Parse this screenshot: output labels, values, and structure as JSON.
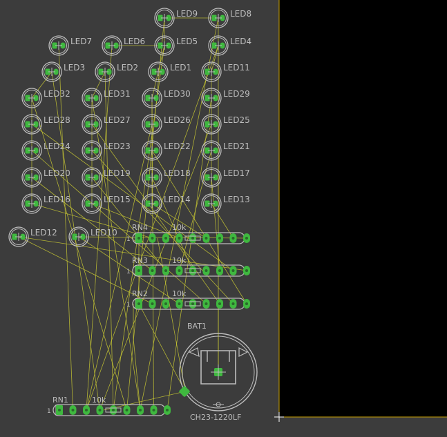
{
  "colors": {
    "background": "#3c3c3c",
    "board_outside": "#000000",
    "board_edge": "#c8a000",
    "silkscreen": "#bdbdbd",
    "pad": "#3fb83f",
    "airwire": "#c8c832"
  },
  "leds": [
    {
      "id": "LED9",
      "label": "LED9"
    },
    {
      "id": "LED8",
      "label": "LED8"
    },
    {
      "id": "LED7",
      "label": "LED7"
    },
    {
      "id": "LED6",
      "label": "LED6"
    },
    {
      "id": "LED5",
      "label": "LED5"
    },
    {
      "id": "LED4",
      "label": "LED4"
    },
    {
      "id": "LED3",
      "label": "LED3"
    },
    {
      "id": "LED2",
      "label": "LED2"
    },
    {
      "id": "LED1",
      "label": "LED1"
    },
    {
      "id": "LED11",
      "label": "LED11"
    },
    {
      "id": "LED32",
      "label": "LED32"
    },
    {
      "id": "LED31",
      "label": "LED31"
    },
    {
      "id": "LED30",
      "label": "LED30"
    },
    {
      "id": "LED29",
      "label": "LED29"
    },
    {
      "id": "LED28",
      "label": "LED28"
    },
    {
      "id": "LED27",
      "label": "LED27"
    },
    {
      "id": "LED26",
      "label": "LED26"
    },
    {
      "id": "LED25",
      "label": "LED25"
    },
    {
      "id": "LED24",
      "label": "LED24"
    },
    {
      "id": "LED23",
      "label": "LED23"
    },
    {
      "id": "LED22",
      "label": "LED22"
    },
    {
      "id": "LED21",
      "label": "LED21"
    },
    {
      "id": "LED20",
      "label": "LED20"
    },
    {
      "id": "LED19",
      "label": "LED19"
    },
    {
      "id": "LED18",
      "label": "LED18"
    },
    {
      "id": "LED17",
      "label": "LED17"
    },
    {
      "id": "LED16",
      "label": "LED16"
    },
    {
      "id": "LED15",
      "label": "LED15"
    },
    {
      "id": "LED14",
      "label": "LED14"
    },
    {
      "id": "LED13",
      "label": "LED13"
    },
    {
      "id": "LED12",
      "label": "LED12"
    },
    {
      "id": "LED10",
      "label": "LED10"
    }
  ],
  "resistor_networks": [
    {
      "id": "RN4",
      "name": "RN4",
      "value": "10k",
      "pin1": "1"
    },
    {
      "id": "RN3",
      "name": "RN3",
      "value": "10k",
      "pin1": "1"
    },
    {
      "id": "RN2",
      "name": "RN2",
      "value": "10k",
      "pin1": "1"
    },
    {
      "id": "RN1",
      "name": "RN1",
      "value": "10k",
      "pin1": "1"
    }
  ],
  "battery": {
    "name": "BAT1",
    "value": "CH23-1220LF"
  }
}
